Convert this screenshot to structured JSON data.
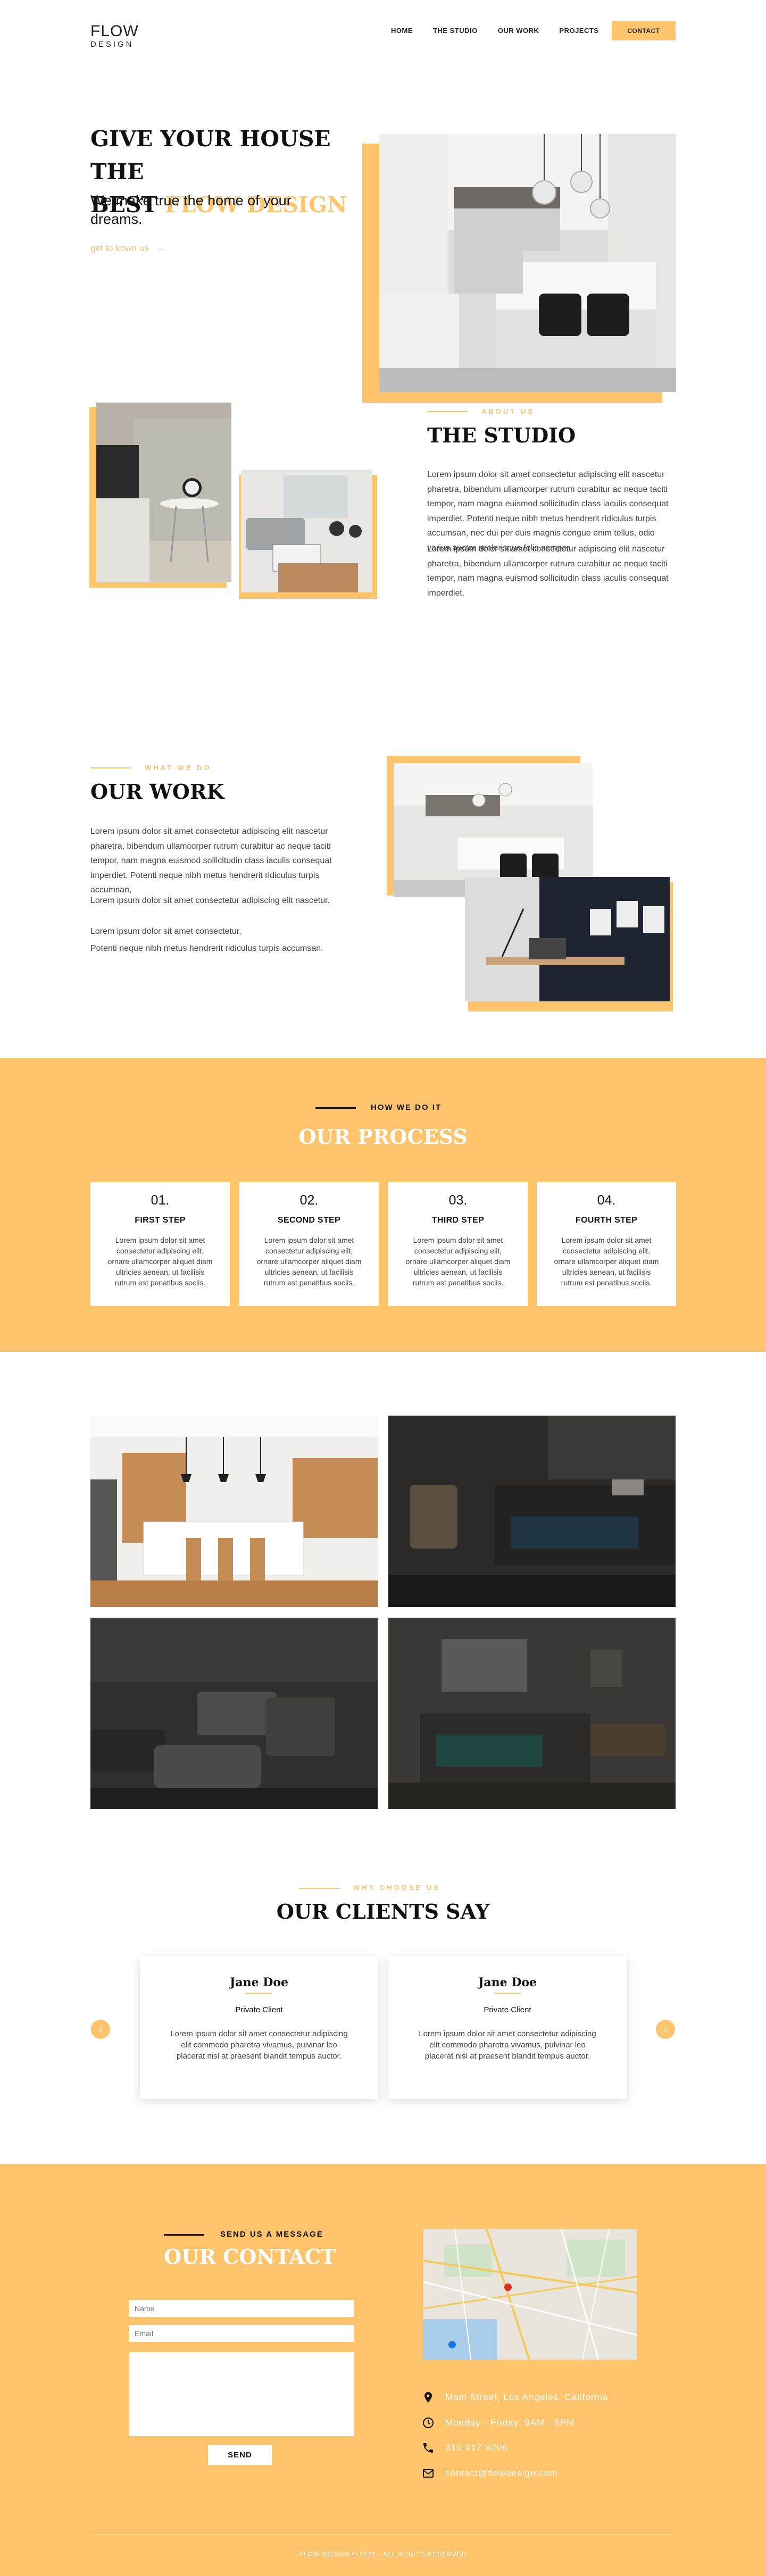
{
  "header": {
    "logo_line1": "FLOW",
    "logo_line2": "DESIGN",
    "nav": [
      "HOME",
      "THE STUDIO",
      "OUR WORK",
      "PROJECTS"
    ],
    "contact_label": "CONTACT"
  },
  "hero": {
    "title_line1": "GIVE YOUR HOUSE THE",
    "title_best": "BEST ",
    "title_accent": "FLOW DESIGN",
    "subtitle": "We make true the home of your dreams.",
    "link": "get to kown us"
  },
  "studio": {
    "eyebrow": "ABOUT US",
    "title": "THE STUDIO",
    "para1": "Lorem ipsum dolor sit amet consectetur adipiscing elit nascetur pharetra, bibendum ullamcorper rutrum curabitur ac neque taciti tempor, nam magna euismod sollicitudin class iaculis consequat imperdiet. Potenti neque nibh metus hendrerit ridiculus turpis accumsan, nec dui per duis magnis congue enim tellus, odio varius auctor scelerisque felis semper.",
    "para2": "Lorem ipsum dolor sit amet consectetur adipiscing elit nascetur pharetra, bibendum ullamcorper rutrum curabitur ac neque taciti tempor, nam magna euismod sollicitudin class iaculis consequat imperdiet."
  },
  "work": {
    "eyebrow": "WHAT WE DO",
    "title": "OUR WORK",
    "para1": "Lorem ipsum dolor sit amet consectetur adipiscing elit nascetur pharetra, bibendum ullamcorper rutrum curabitur ac neque taciti tempor, nam magna euismod sollicitudin class iaculis consequat imperdiet. Potenti neque nibh metus hendrerit ridiculus turpis accumsan,",
    "para2": "Lorem ipsum dolor sit amet consectetur adipiscing elit nascetur.",
    "para3": "Lorem ipsum dolor sit amet consectetur.",
    "para4": "Potenti neque nibh metus hendrerit ridiculus turpis accumsan."
  },
  "process": {
    "eyebrow": "HOW WE DO IT",
    "title": "OUR PROCESS",
    "cards": [
      {
        "num": "01.",
        "step": "FIRST STEP",
        "text": "Lorem ipsum dolor sit amet consectetur adipiscing elit, ornare ullamcorper aliquet diam ultricies aenean, ut facilisis rutrum est penatibus sociis."
      },
      {
        "num": "02.",
        "step": "SECOND STEP",
        "text": "Lorem ipsum dolor sit amet consectetur adipiscing elit, ornare ullamcorper aliquet diam ultricies aenean, ut facilisis rutrum est penatibus sociis."
      },
      {
        "num": "03.",
        "step": "THIRD STEP",
        "text": "Lorem ipsum dolor sit amet consectetur adipiscing elit, ornare ullamcorper aliquet diam ultricies aenean, ut facilisis rutrum est penatibus sociis."
      },
      {
        "num": "04.",
        "step": "FOURTH STEP",
        "text": "Lorem ipsum dolor sit amet consectetur adipiscing elit, ornare ullamcorper aliquet diam ultricies aenean, ut facilisis rutrum est penatibus sociis."
      }
    ]
  },
  "clients": {
    "eyebrow": "WHY CHOOSE US",
    "title": "OUR CLIENTS SAY",
    "testimonials": [
      {
        "name": "Jane Doe",
        "role": "Private Client",
        "quote": "Lorem ipsum dolor sit amet consectetur adipiscing elit commodo pharetra vivamus, pulvinar leo placerat nisl at praesent blandit tempus auctor."
      },
      {
        "name": "Jane Doe",
        "role": "Private Client",
        "quote": "Lorem ipsum dolor sit amet consectetur adipiscing elit commodo pharetra vivamus, pulvinar leo placerat nisl at praesent blandit tempus auctor."
      }
    ],
    "prev_icon": "chevron-left-icon",
    "next_icon": "chevron-right-icon"
  },
  "contact": {
    "eyebrow": "SEND US A MESSAGE",
    "title": "OUR CONTACT",
    "name_placeholder": "Name",
    "email_placeholder": "Email",
    "message_placeholder": "",
    "send_label": "SEND",
    "address": "Main Street, Los Angeles, California",
    "hours": "Monday - Friday: 9AM - 5PM",
    "phone": "310-617-8206",
    "email": "contact@flowdesign.com",
    "copyright": "FLOW DESIGN © 2021 - ALL RIGHTS RESERVED"
  },
  "colors": {
    "accent": "#ffc46c",
    "dark": "#111111",
    "white": "#ffffff"
  }
}
